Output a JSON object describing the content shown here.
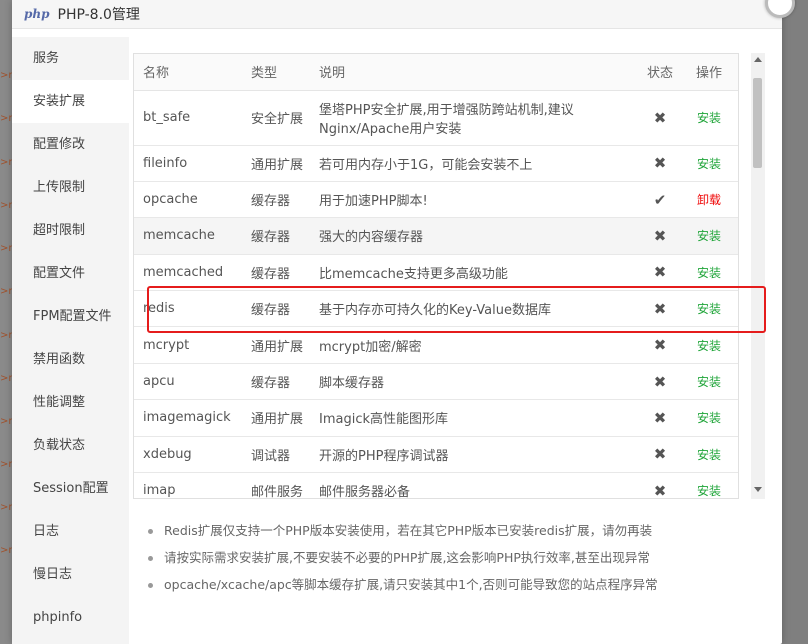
{
  "window": {
    "logo_text": "php",
    "title": "PHP-8.0管理"
  },
  "background": {
    "marks": [
      ">n",
      ">n",
      ">n",
      ">n",
      ">n",
      ">n",
      ">n",
      ">n",
      ">n",
      ">n",
      ">n",
      ">n"
    ]
  },
  "sidebar": {
    "items": [
      {
        "label": "服务"
      },
      {
        "label": "安装扩展"
      },
      {
        "label": "配置修改"
      },
      {
        "label": "上传限制"
      },
      {
        "label": "超时限制"
      },
      {
        "label": "配置文件"
      },
      {
        "label": "FPM配置文件"
      },
      {
        "label": "禁用函数"
      },
      {
        "label": "性能调整"
      },
      {
        "label": "负载状态"
      },
      {
        "label": "Session配置"
      },
      {
        "label": "日志"
      },
      {
        "label": "慢日志"
      },
      {
        "label": "phpinfo"
      }
    ],
    "active_index": 1
  },
  "table": {
    "headers": {
      "name": "名称",
      "type": "类型",
      "desc": "说明",
      "status": "状态",
      "action": "操作"
    },
    "rows": [
      {
        "name": "bt_safe",
        "type": "安全扩展",
        "desc": "堡塔PHP安全扩展,用于增强防跨站机制,建议Nginx/Apache用户安装",
        "status": "✖",
        "action": "安装"
      },
      {
        "name": "fileinfo",
        "type": "通用扩展",
        "desc": "若可用内存小于1G，可能会安装不上",
        "status": "✖",
        "action": "安装"
      },
      {
        "name": "opcache",
        "type": "缓存器",
        "desc": "用于加速PHP脚本!",
        "status": "✔",
        "action": "卸载"
      },
      {
        "name": "memcache",
        "type": "缓存器",
        "desc": "强大的内容缓存器",
        "status": "✖",
        "action": "安装"
      },
      {
        "name": "memcached",
        "type": "缓存器",
        "desc": "比memcache支持更多高级功能",
        "status": "✖",
        "action": "安装"
      },
      {
        "name": "redis",
        "type": "缓存器",
        "desc": "基于内存亦可持久化的Key-Value数据库",
        "status": "✖",
        "action": "安装"
      },
      {
        "name": "mcrypt",
        "type": "通用扩展",
        "desc": "mcrypt加密/解密",
        "status": "✖",
        "action": "安装"
      },
      {
        "name": "apcu",
        "type": "缓存器",
        "desc": "脚本缓存器",
        "status": "✖",
        "action": "安装"
      },
      {
        "name": "imagemagick",
        "type": "通用扩展",
        "desc": "Imagick高性能图形库",
        "status": "✖",
        "action": "安装"
      },
      {
        "name": "xdebug",
        "type": "调试器",
        "desc": "开源的PHP程序调试器",
        "status": "✖",
        "action": "安装"
      },
      {
        "name": "imap",
        "type": "邮件服务",
        "desc": "邮件服务器必备",
        "status": "✖",
        "action": "安装"
      }
    ]
  },
  "notes": [
    "Redis扩展仅支持一个PHP版本安装使用，若在其它PHP版本已安装redis扩展，请勿再装",
    "请按实际需求安装扩展,不要安装不必要的PHP扩展,这会影响PHP执行效率,甚至出现异常",
    "opcache/xcache/apc等脚本缓存扩展,请只安装其中1个,否则可能导致您的站点程序异常"
  ],
  "colors": {
    "install": "#20a53a",
    "uninstall": "#ef0808",
    "highlight": "#e51c1c"
  }
}
